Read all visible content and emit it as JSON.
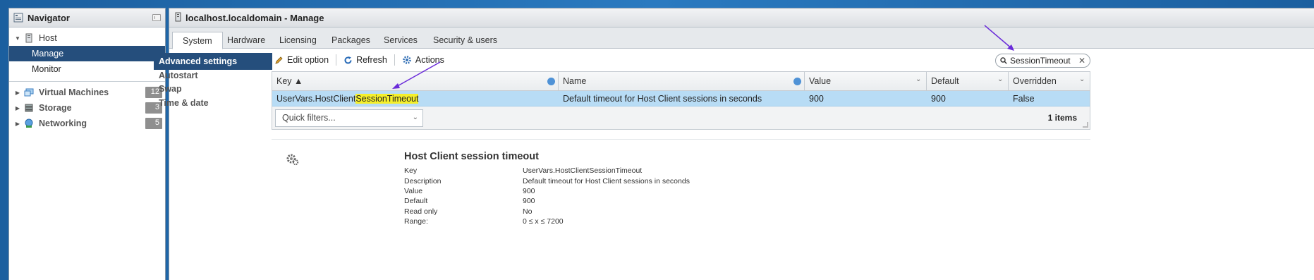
{
  "navigator": {
    "title": "Navigator",
    "host": "Host",
    "host_items": [
      "Manage",
      "Monitor"
    ],
    "groups": [
      {
        "label": "Virtual Machines",
        "count": "12",
        "icon": "vm-icon"
      },
      {
        "label": "Storage",
        "count": "3",
        "icon": "storage-icon"
      },
      {
        "label": "Networking",
        "count": "5",
        "icon": "network-icon"
      }
    ]
  },
  "main": {
    "title": "localhost.localdomain - Manage",
    "tabs": [
      "System",
      "Hardware",
      "Licensing",
      "Packages",
      "Services",
      "Security & users"
    ],
    "active_tab": "System",
    "settings_menu": [
      "Advanced settings",
      "Autostart",
      "Swap",
      "Time & date"
    ],
    "toolbar": {
      "edit": "Edit option",
      "refresh": "Refresh",
      "actions": "Actions"
    },
    "search": {
      "value": "SessionTimeout"
    },
    "grid": {
      "columns": [
        "Key ▲",
        "Name",
        "Value",
        "Default",
        "Overridden"
      ],
      "rows": [
        {
          "key_prefix": "UserVars.HostClient",
          "key_match": "SessionTimeout",
          "name": "Default timeout for Host Client sessions in seconds",
          "value": "900",
          "default": "900",
          "overridden": "False"
        }
      ],
      "quick_filters": "Quick filters...",
      "count_text": "1 items"
    },
    "detail": {
      "title": "Host Client session timeout",
      "fields": [
        {
          "label": "Key",
          "value": "UserVars.HostClientSessionTimeout"
        },
        {
          "label": "Description",
          "value": "Default timeout for Host Client sessions in seconds"
        },
        {
          "label": "Value",
          "value": "900"
        },
        {
          "label": "Default",
          "value": "900"
        },
        {
          "label": "Read only",
          "value": "No"
        },
        {
          "label": "Range:",
          "value": "0 ≤ x ≤ 7200"
        }
      ]
    }
  },
  "colors": {
    "selection": "#254e7c",
    "row_highlight": "#b8dcf5",
    "match_highlight": "#f5ef2b",
    "annotation_arrow": "#6a2bd9"
  }
}
